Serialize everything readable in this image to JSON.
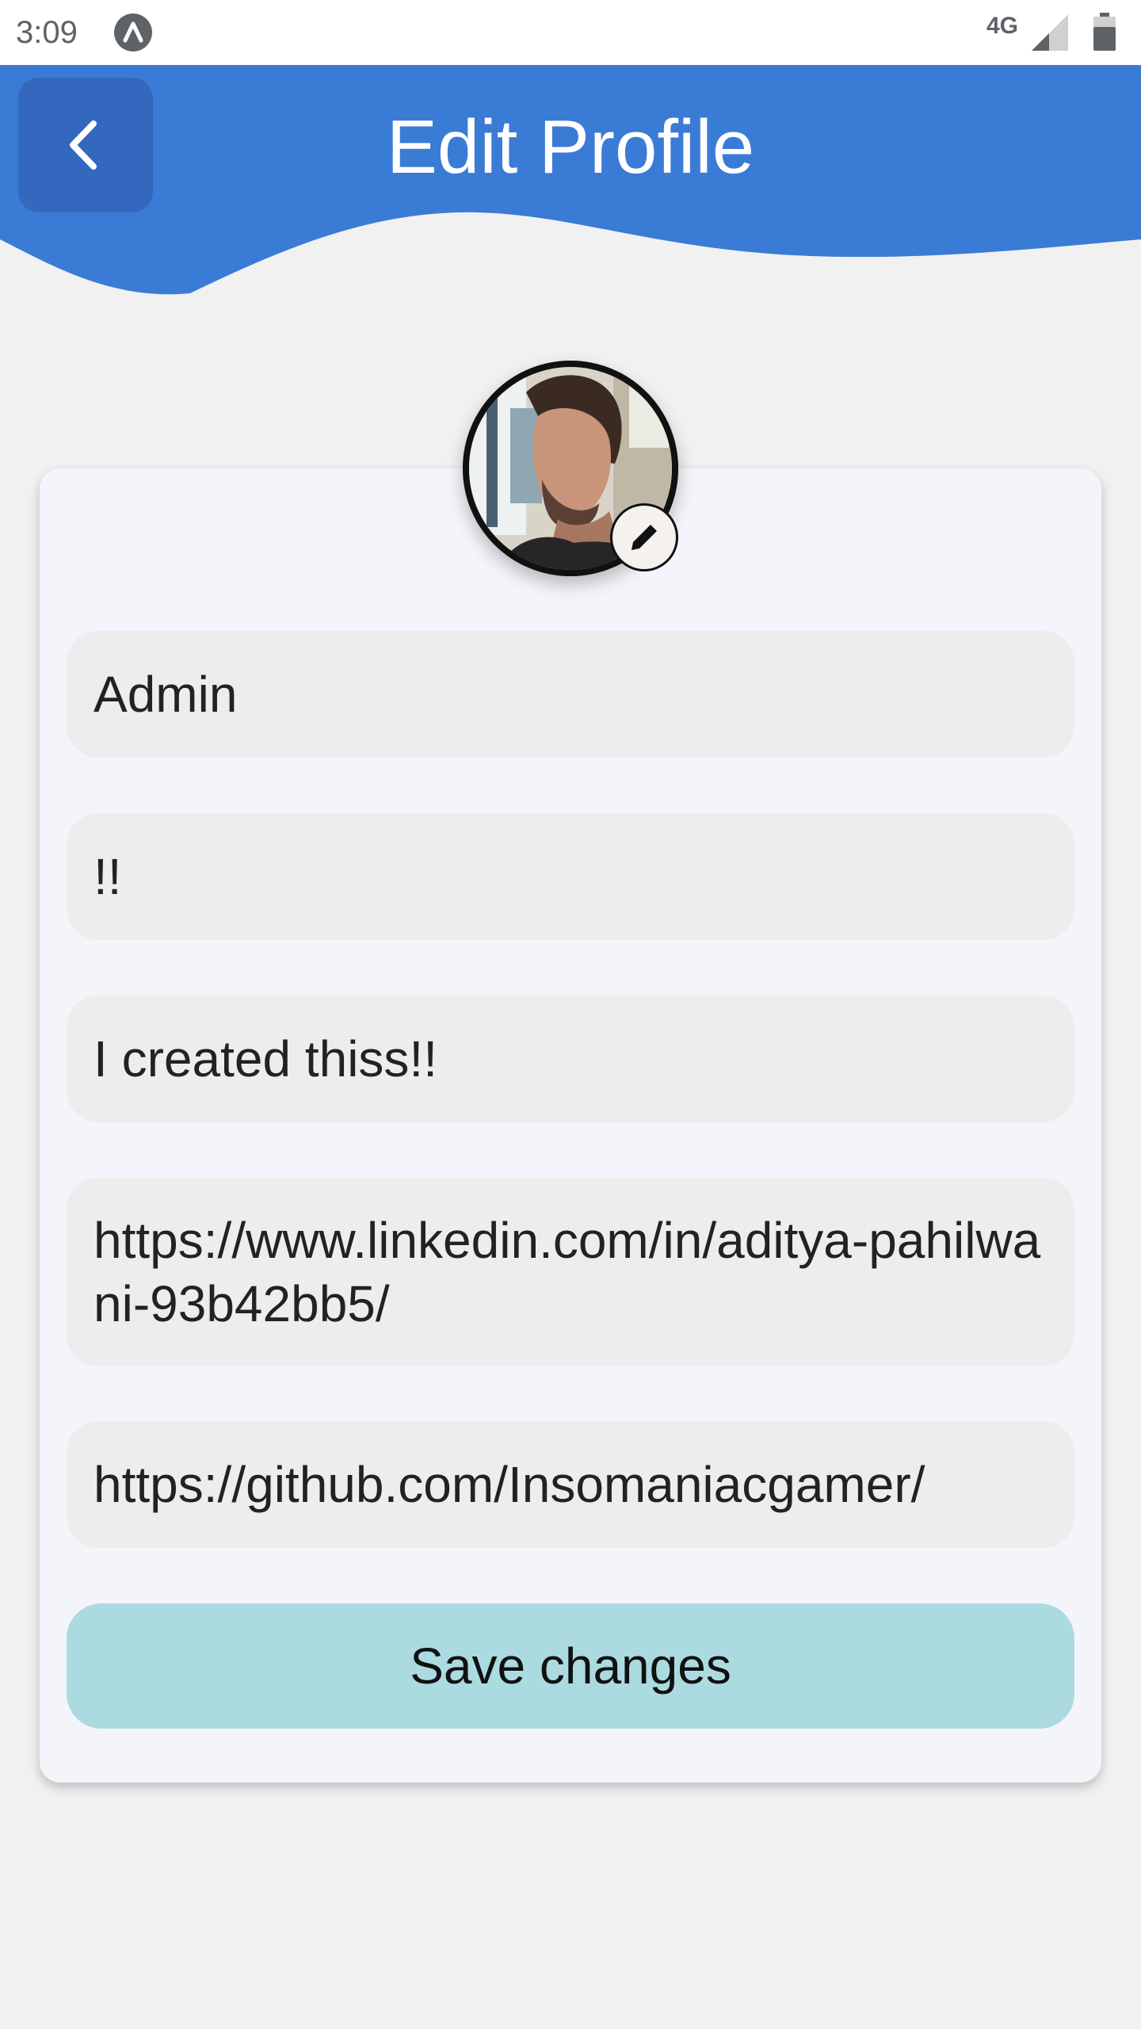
{
  "status_bar": {
    "time": "3:09",
    "network": "4G",
    "app_icon": "android-studio-icon",
    "signal_icon": "signal-icon",
    "battery_icon": "battery-icon"
  },
  "header": {
    "title": "Edit Profile",
    "back_icon": "chevron-left-icon",
    "color": "#3a7bd5"
  },
  "profile": {
    "avatar_icon": "avatar-photo",
    "edit_icon": "pencil-icon"
  },
  "form": {
    "name": "Admin",
    "status": "!!",
    "bio": "I created thiss!!",
    "linkedin": "https://www.linkedin.com/in/aditya-pahilwani-93b42bb5/",
    "github": "https://github.com/Insomaniacgamer/"
  },
  "actions": {
    "save_label": "Save changes",
    "save_color": "#abdbe0"
  }
}
